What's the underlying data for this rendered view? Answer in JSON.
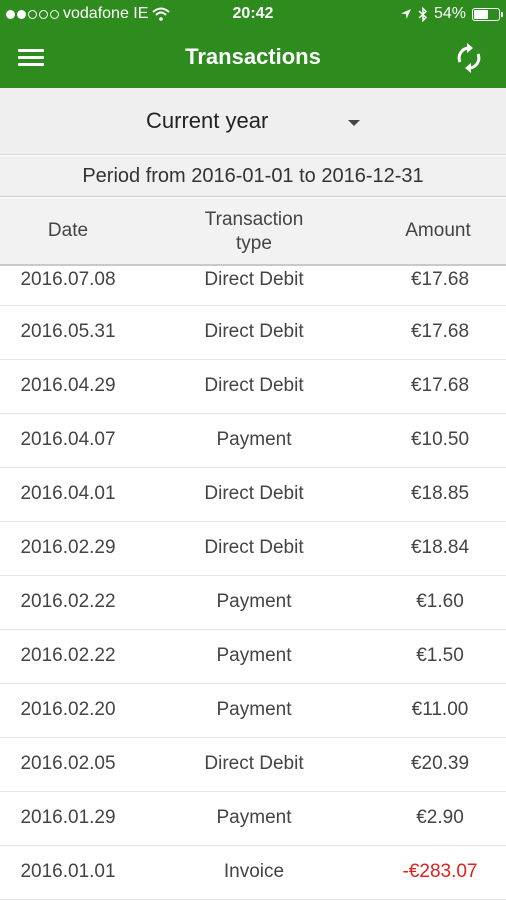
{
  "status_bar": {
    "carrier": "vodafone IE",
    "time": "20:42",
    "battery_percent": "54%",
    "battery_level": 0.54,
    "icons": [
      "signal-dots-icon",
      "wifi-icon",
      "location-arrow-icon",
      "bluetooth-icon",
      "battery-icon"
    ]
  },
  "app_bar": {
    "title": "Transactions",
    "menu_icon": "hamburger-menu-icon",
    "sync_icon": "sync-icon",
    "color": "#2e8b1e"
  },
  "filter": {
    "selected": "Current year"
  },
  "period": "Period from 2016-01-01 to 2016-12-31",
  "table": {
    "columns": [
      "Date",
      "Transaction type",
      "Amount"
    ],
    "type_header_line1": "Transaction",
    "type_header_line2": "type",
    "rows": [
      {
        "date": "2016.07.08",
        "type": "Direct Debit",
        "amount": "€17.68"
      },
      {
        "date": "2016.05.31",
        "type": "Direct Debit",
        "amount": "€17.68"
      },
      {
        "date": "2016.04.29",
        "type": "Direct Debit",
        "amount": "€17.68"
      },
      {
        "date": "2016.04.07",
        "type": "Payment",
        "amount": "€10.50"
      },
      {
        "date": "2016.04.01",
        "type": "Direct Debit",
        "amount": "€18.85"
      },
      {
        "date": "2016.02.29",
        "type": "Direct Debit",
        "amount": "€18.84"
      },
      {
        "date": "2016.02.22",
        "type": "Payment",
        "amount": "€1.60"
      },
      {
        "date": "2016.02.22",
        "type": "Payment",
        "amount": "€1.50"
      },
      {
        "date": "2016.02.20",
        "type": "Payment",
        "amount": "€11.00"
      },
      {
        "date": "2016.02.05",
        "type": "Direct Debit",
        "amount": "€20.39"
      },
      {
        "date": "2016.01.29",
        "type": "Payment",
        "amount": "€2.90"
      },
      {
        "date": "2016.01.01",
        "type": "Invoice",
        "amount": "-€283.07",
        "negative": true
      }
    ]
  },
  "colors": {
    "negative": "#e4201e"
  }
}
